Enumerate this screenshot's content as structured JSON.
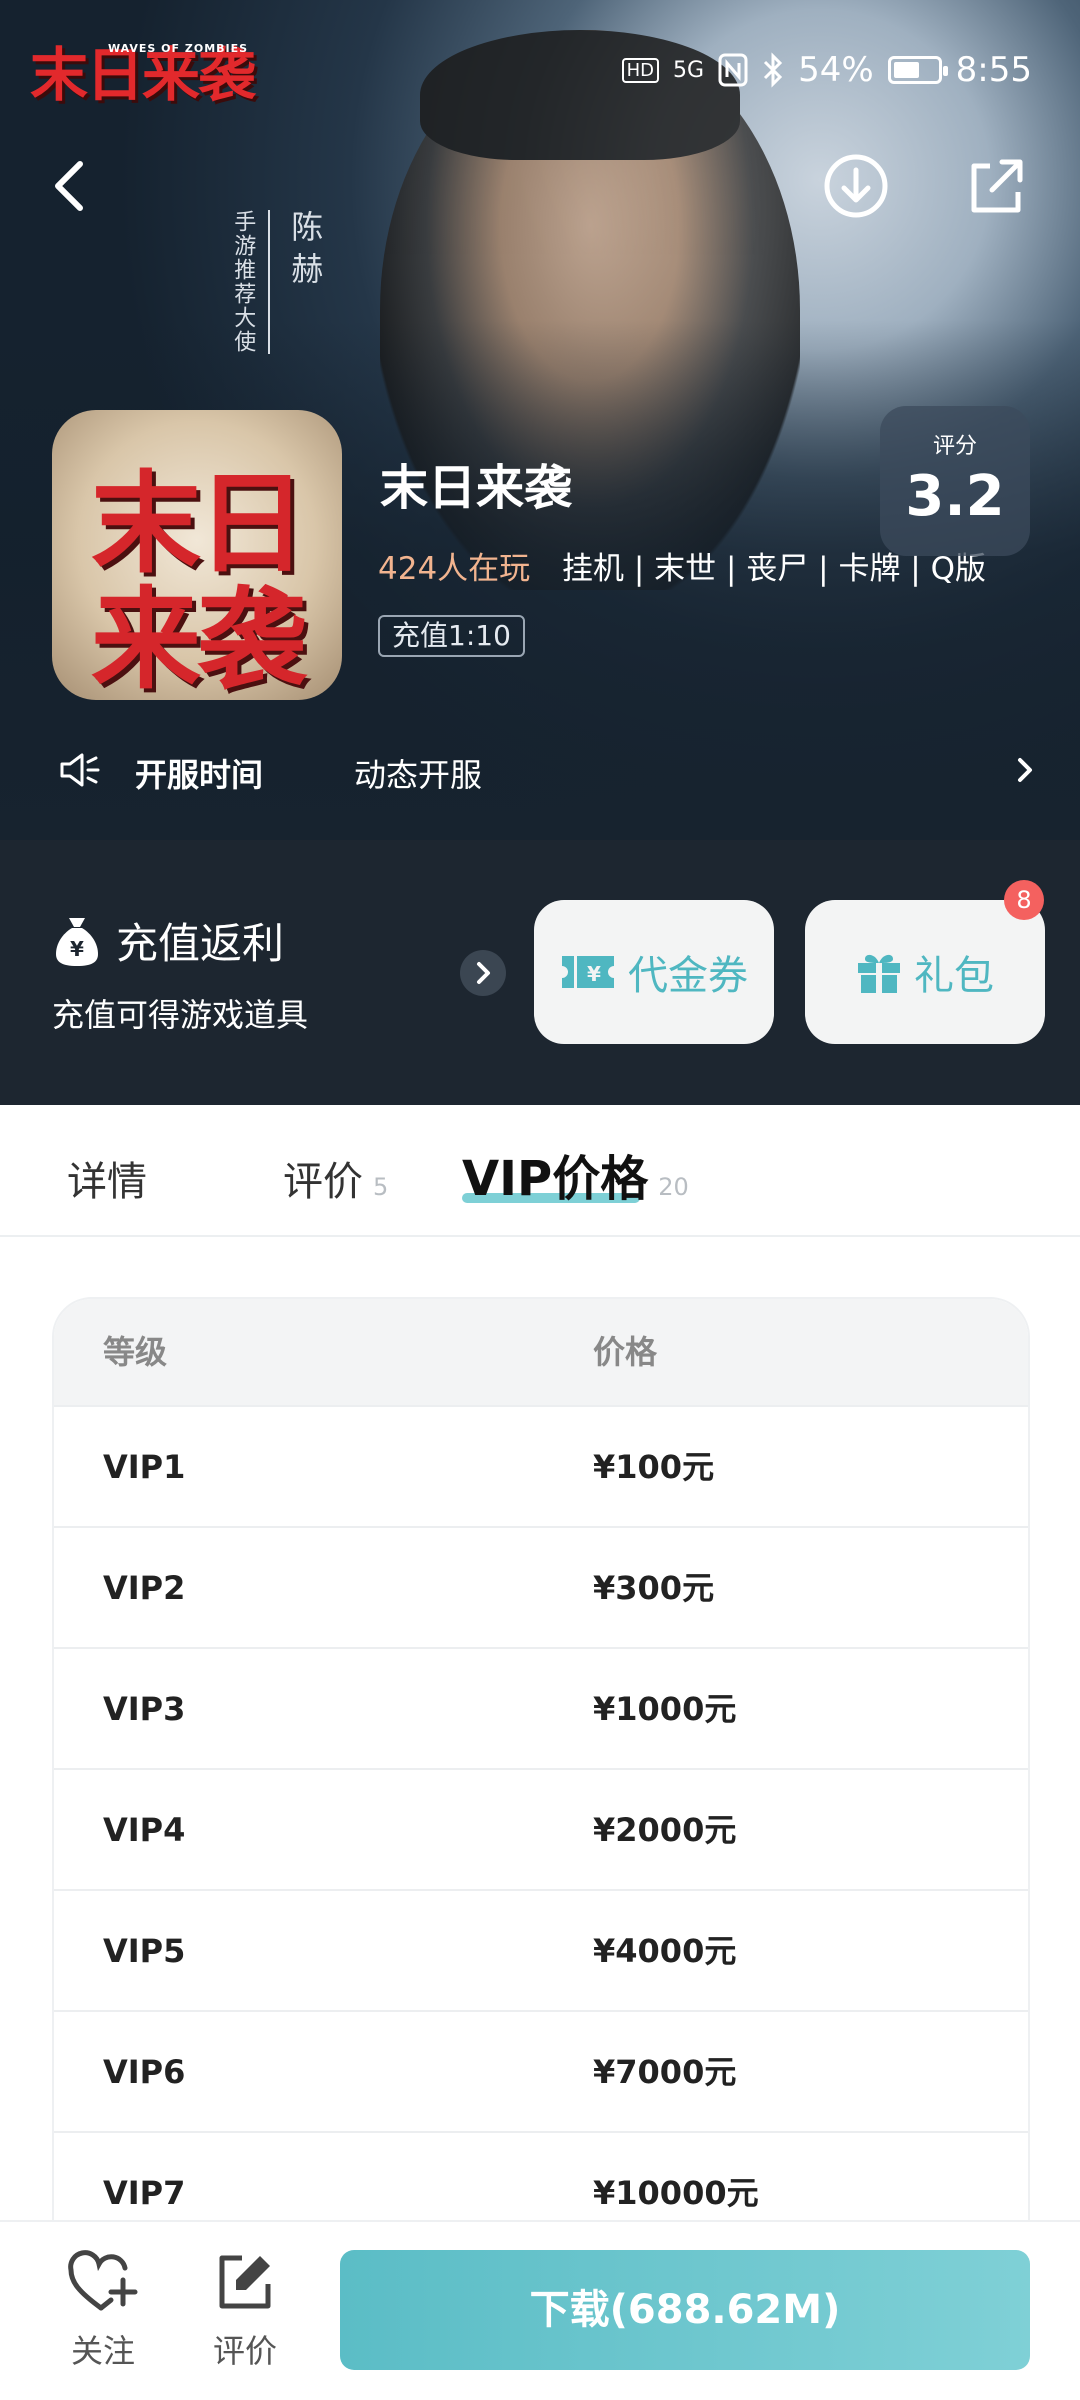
{
  "status_bar": {
    "brand": "末日来袭",
    "brand_sub": "WAVES OF ZOMBIES",
    "hd": "HD",
    "signal": "5G",
    "battery": "54%",
    "time": "8:55"
  },
  "hero": {
    "ambassador_role": "手游推荐大使",
    "ambassador_name": "陈赫",
    "icon_text_top": "末日",
    "icon_text_bottom": "来袭",
    "title": "末日来袭",
    "players": "424人在玩",
    "tags": "挂机 | 末世 | 丧尸 | 卡牌 | Q版",
    "recharge_ratio": "充值1:10",
    "rating_label": "评分",
    "rating_value": "3.2"
  },
  "server": {
    "label": "开服时间",
    "value": "动态开服"
  },
  "rebate": {
    "title": "充值返利",
    "subtitle": "充值可得游戏道具",
    "voucher_label": "代金券",
    "gift_label": "礼包",
    "gift_badge": "8"
  },
  "tabs": {
    "details": "详情",
    "reviews": "评价",
    "reviews_count": "5",
    "vip": "VIP价格",
    "vip_count": "20"
  },
  "vip_table": {
    "headers": [
      "等级",
      "价格"
    ],
    "rows": [
      [
        "VIP1",
        "¥100元"
      ],
      [
        "VIP2",
        "¥300元"
      ],
      [
        "VIP3",
        "¥1000元"
      ],
      [
        "VIP4",
        "¥2000元"
      ],
      [
        "VIP5",
        "¥4000元"
      ],
      [
        "VIP6",
        "¥7000元"
      ],
      [
        "VIP7",
        "¥10000元"
      ]
    ]
  },
  "bottom_bar": {
    "follow": "关注",
    "review": "评价",
    "download": "下载(688.62M)"
  },
  "colors": {
    "accent": "#5bbdc6",
    "players": "#f2b48f",
    "badge": "#f4615f",
    "band": "#1d2630"
  }
}
